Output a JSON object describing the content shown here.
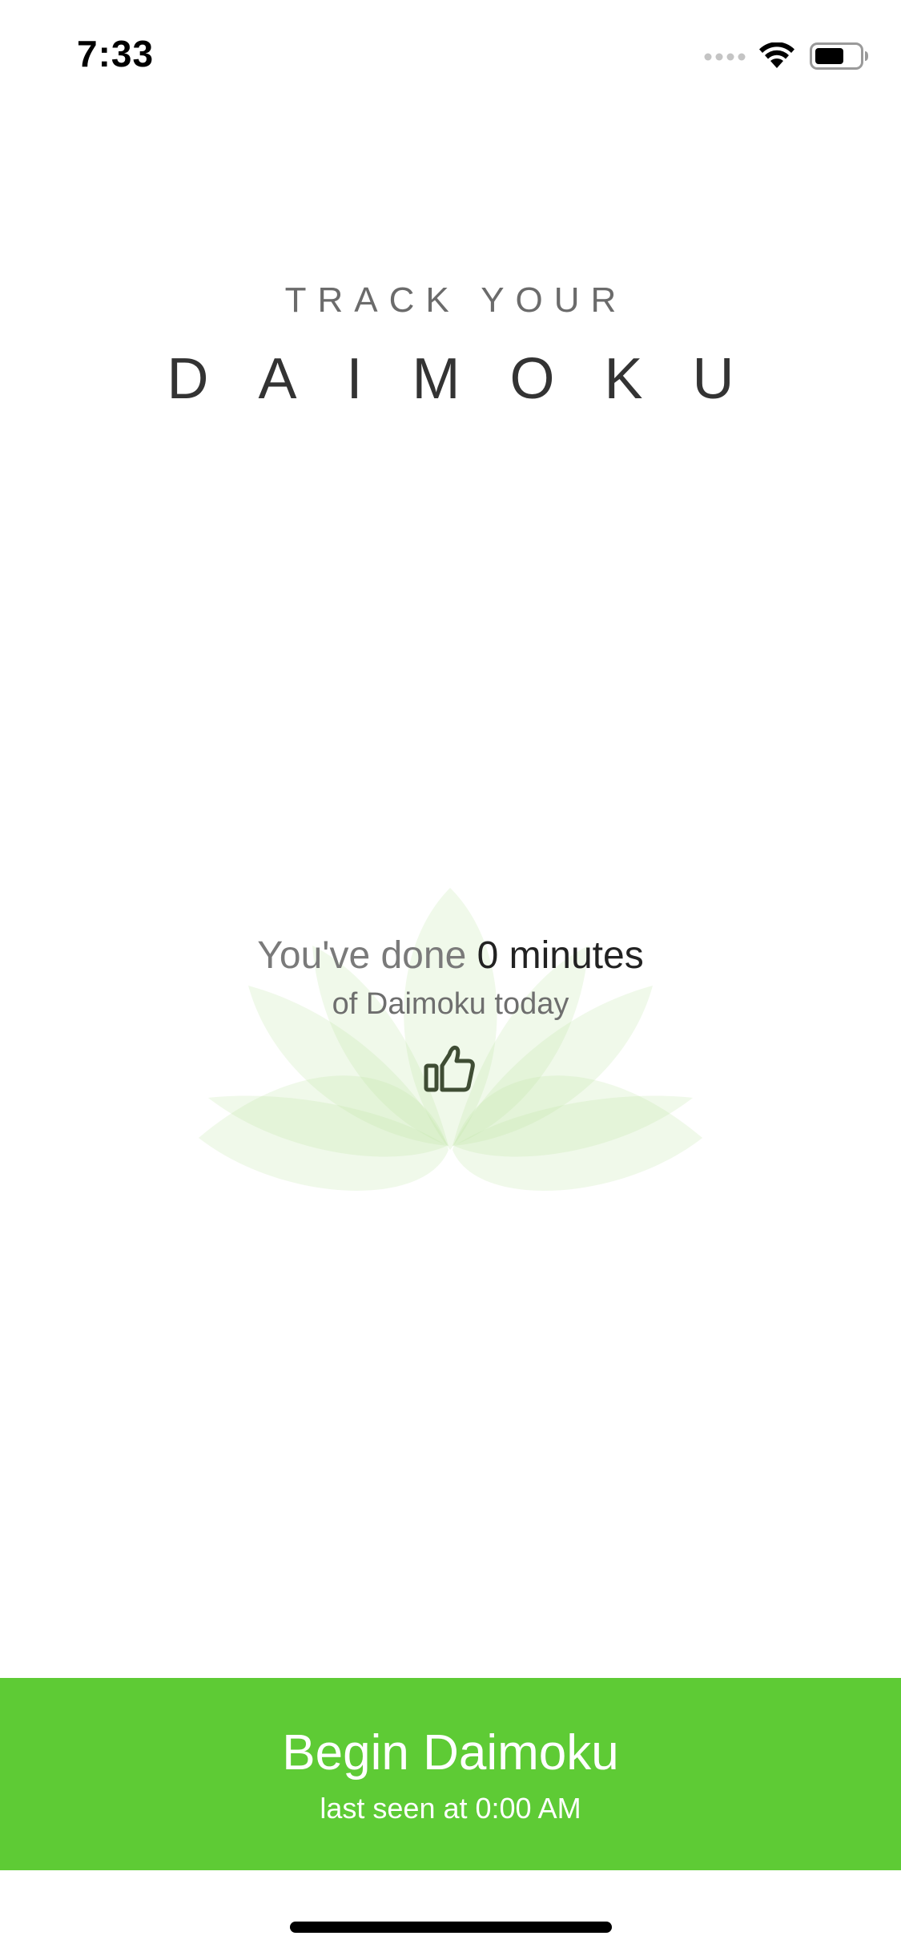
{
  "status_bar": {
    "time": "7:33",
    "icons": [
      "cellular-signal-icon",
      "wifi-icon",
      "battery-icon"
    ]
  },
  "header": {
    "subtitle": "TRACK YOUR",
    "title": "DAIMOKU"
  },
  "summary": {
    "prefix": "You've done",
    "minutes": "0 minutes",
    "suffix": "of Daimoku today",
    "icon": "thumbs-up-icon",
    "background_icon": "lotus-icon"
  },
  "begin_button": {
    "label": "Begin Daimoku",
    "sublabel": "last seen at 0:00 AM"
  },
  "colors": {
    "accent": "#5ecb35",
    "lotus": "#eaf6e2",
    "text_primary": "#222222",
    "text_secondary": "#7a7a7a"
  }
}
